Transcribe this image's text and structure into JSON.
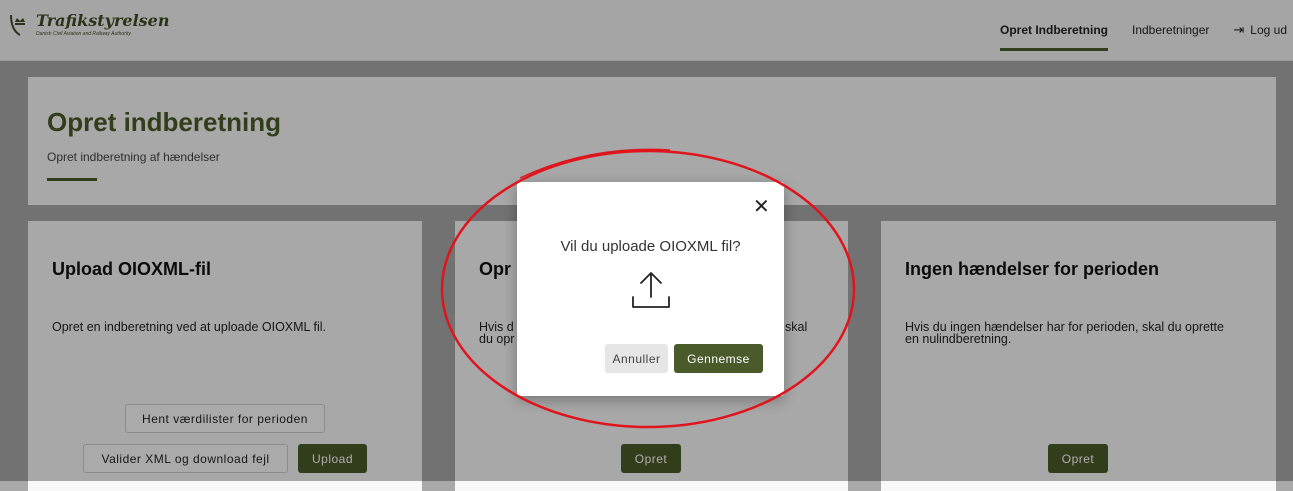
{
  "header": {
    "logo": {
      "name": "Trafikstyrelsen",
      "tagline": "Danish Civil Aviation and Railway Authority"
    },
    "nav": [
      {
        "label": "Opret Indberetning",
        "active": true
      },
      {
        "label": "Indberetninger",
        "active": false
      },
      {
        "label": "Log ud",
        "icon": "logout-icon"
      }
    ]
  },
  "page": {
    "title": "Opret indberetning",
    "subtitle": "Opret indberetning af hændelser"
  },
  "cards": [
    {
      "title": "Upload OIOXML-fil",
      "description": "Opret en indberetning ved at uploade OIOXML fil.",
      "buttons": {
        "get_value_lists": "Hent værdilister for perioden",
        "validate": "Valider XML og download fejl",
        "upload": "Upload"
      }
    },
    {
      "title": "Opr",
      "description_line1": "Hvis d",
      "description_line1_end": "skal",
      "description_line2": "du opr",
      "button": "Opret"
    },
    {
      "title": "Ingen hændelser for perioden",
      "description": "Hvis du ingen hændelser har for perioden, skal du oprette en nulindberetning.",
      "button": "Opret"
    }
  ],
  "modal": {
    "title": "Vil du uploade OIOXML fil?",
    "close_icon": "close-icon",
    "upload_icon": "upload-icon",
    "cancel_label": "Annuller",
    "browse_label": "Gennemse"
  },
  "colors": {
    "brand": "#4a5a2a",
    "annotation": "#e0141c"
  }
}
